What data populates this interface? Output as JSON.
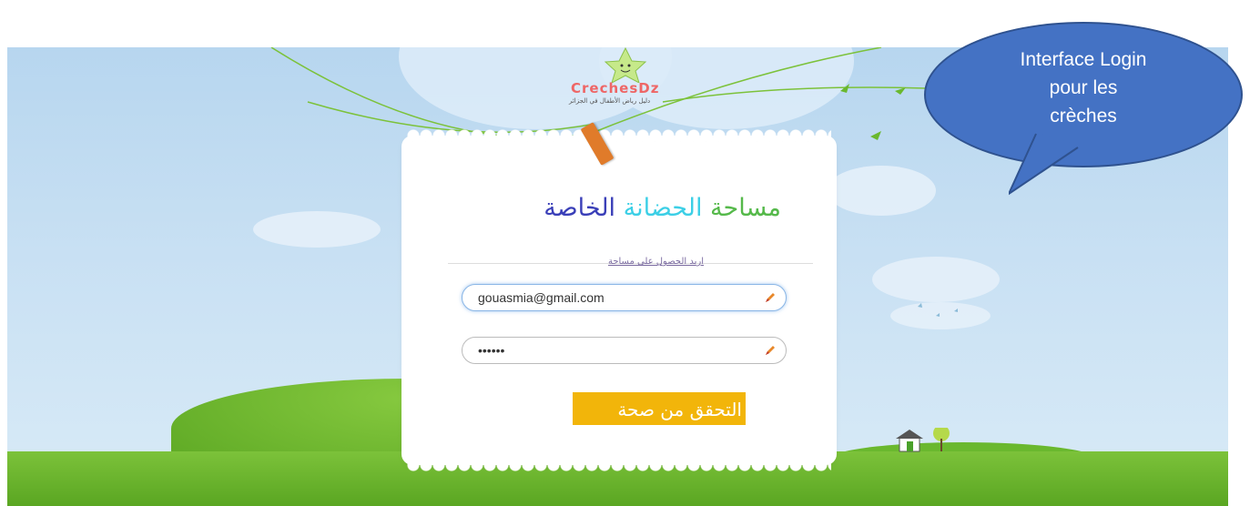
{
  "logo": {
    "name": "CrechesDz",
    "tagline": "دليل رياض الأطفال في الجزائر"
  },
  "login": {
    "title_part1": "مساحة",
    "title_part2": "الحضانة",
    "title_part3": "الخاصة",
    "request_link": "اريد الحصول على مساحة",
    "email_value": "gouasmia@gmail.com",
    "password_value": "••••••",
    "submit_label": "التحقق من صحة"
  },
  "callout": {
    "text": "Interface Login\npour les\ncrèches"
  },
  "colors": {
    "title_green": "#55b94a",
    "title_cyan": "#3ccfe6",
    "title_blue": "#3a3fb8",
    "submit_bg": "#f2b50a",
    "callout_bg": "#4472c4"
  },
  "icons": {
    "field_icon": "pencil-icon"
  }
}
